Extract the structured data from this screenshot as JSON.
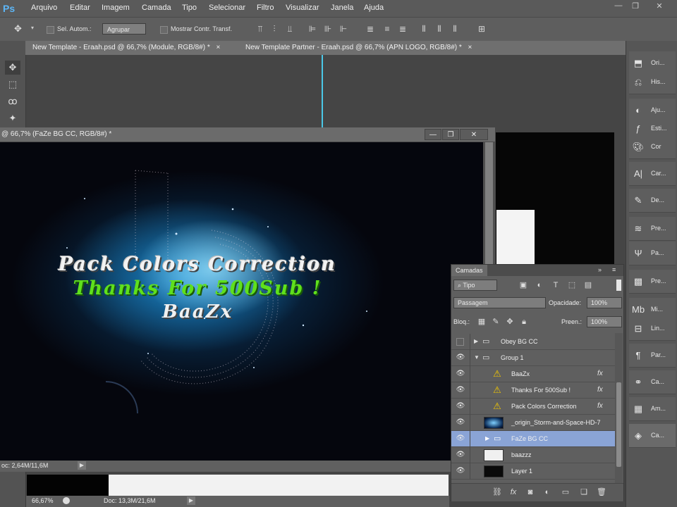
{
  "app": {
    "logo": "Ps",
    "menu": [
      "Arquivo",
      "Editar",
      "Imagem",
      "Camada",
      "Tipo",
      "Selecionar",
      "Filtro",
      "Visualizar",
      "Janela",
      "Ajuda"
    ],
    "window_buttons": [
      "—",
      "❐",
      "✕"
    ]
  },
  "options_bar": {
    "auto_select_label": "Sel. Autom.:",
    "auto_select_value": "Agrupar",
    "show_transform_label": "Mostrar Contr. Transf."
  },
  "tabs": [
    {
      "label": "New Template - Eraah.psd @ 66,7% (Module, RGB/8#) *",
      "close": "×"
    },
    {
      "label": "New Template Partner - Eraah.psd @ 66,7% (APN LOGO, RGB/8#) *",
      "close": "×"
    }
  ],
  "floating_doc": {
    "title": "@ 66,7% (FaZe BG CC, RGB/8#) *",
    "status": "oc: 2,64M/11,6M",
    "canvas_lines": [
      "Pack Colors Correction",
      "Thanks For 500Sub !",
      "BaaZx"
    ]
  },
  "main_status": {
    "zoom": "66,67%",
    "doc": "Doc: 13,3M/21,6M"
  },
  "layers_panel": {
    "title": "Camadas",
    "filter_value": "Tipo",
    "blend_mode": "Passagem",
    "opacity_label": "Opacidade:",
    "opacity_value": "100%",
    "lock_label": "Bloq.:",
    "fill_label": "Preen.:",
    "fill_value": "100%",
    "layers": [
      {
        "name": "Obey BG CC",
        "kind": "group"
      },
      {
        "name": "Group 1",
        "kind": "group-open"
      },
      {
        "name": "BaaZx",
        "kind": "text",
        "fx": "fx"
      },
      {
        "name": "Thanks For 500Sub !",
        "kind": "text",
        "fx": "fx"
      },
      {
        "name": "Pack Colors Correction",
        "kind": "text",
        "fx": "fx"
      },
      {
        "name": "_origin_Storm-and-Space-HD-7",
        "kind": "image"
      },
      {
        "name": "FaZe BG CC",
        "kind": "group-selected"
      },
      {
        "name": "baazzz",
        "kind": "image"
      },
      {
        "name": "Layer 1",
        "kind": "image"
      }
    ]
  },
  "dock": {
    "items": [
      "Ori...",
      "His...",
      "Aju...",
      "Esti...",
      "Cor",
      "Car...",
      "De...",
      "Pre...",
      "Pa...",
      "Pre...",
      "Mi...",
      "Lin...",
      "Par...",
      "Ca...",
      "Am...",
      "Ca..."
    ]
  }
}
